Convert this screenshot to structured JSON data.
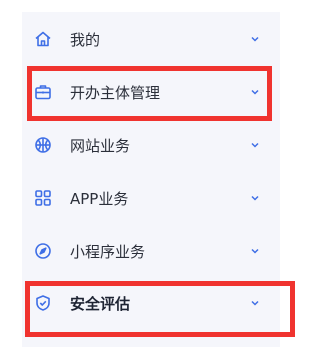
{
  "colors": {
    "accent": "#3f6fe6",
    "highlight": "#f0332f",
    "panel_bg": "#f5f6fb"
  },
  "menu": {
    "items": [
      {
        "label": "我的",
        "icon": "home-icon"
      },
      {
        "label": "开办主体管理",
        "icon": "briefcase-icon",
        "highlighted": true
      },
      {
        "label": "网站业务",
        "icon": "basketball-icon"
      },
      {
        "label": "APP业务",
        "icon": "grid-icon"
      },
      {
        "label": "小程序业务",
        "icon": "compass-icon"
      },
      {
        "label": "安全评估",
        "icon": "shield-check-icon",
        "highlighted": true,
        "active": true
      }
    ]
  }
}
